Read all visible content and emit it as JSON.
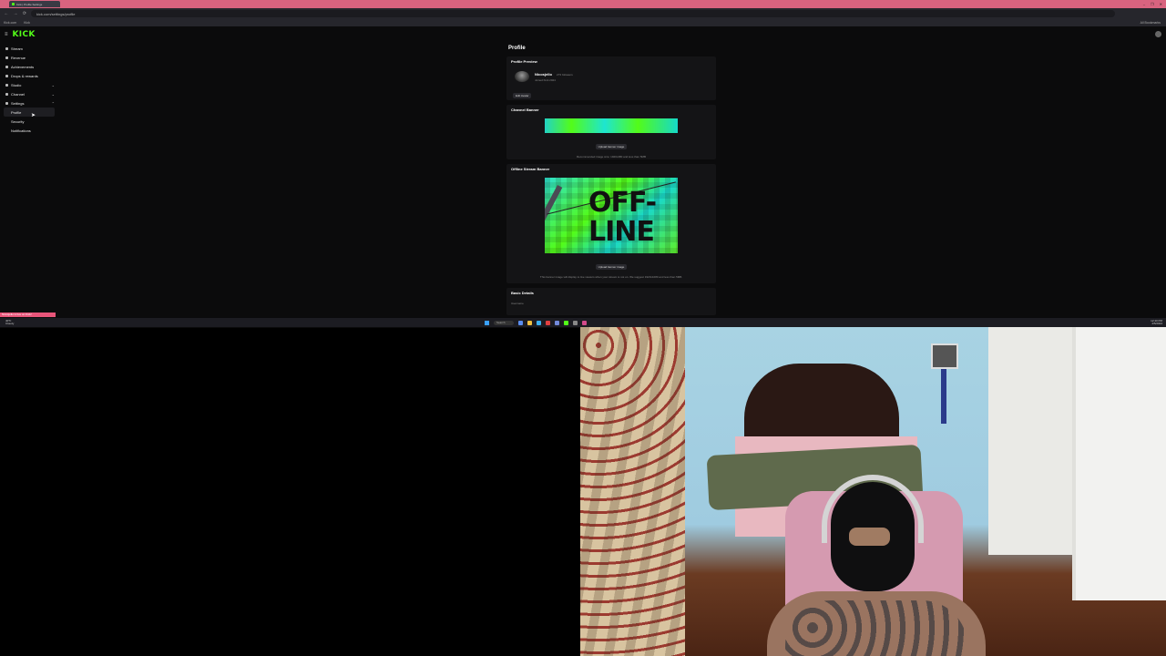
{
  "browser": {
    "tab_title": "Kick | Profile Settings",
    "url": "kick.com/settings/profile",
    "nav": {
      "back": "←",
      "forward": "→",
      "reload": "⟳"
    },
    "bookmarks": [
      "Kick.com",
      "Kick",
      "All Bookmarks"
    ],
    "window_controls": [
      "–",
      "❐",
      "✕"
    ]
  },
  "site": {
    "logo": "KICK",
    "menu_icon": "≡"
  },
  "sidebar": {
    "items": [
      {
        "label": "Stream",
        "icon": "camera-icon"
      },
      {
        "label": "Revenue",
        "icon": "dollar-icon"
      },
      {
        "label": "Achievements",
        "icon": "trophy-icon"
      },
      {
        "label": "Drops & rewards",
        "icon": "gift-icon"
      },
      {
        "label": "Studio",
        "icon": "video-icon",
        "chevron": "⌄"
      },
      {
        "label": "Channel",
        "icon": "tv-icon",
        "chevron": "⌄"
      },
      {
        "label": "Settings",
        "icon": "gear-icon",
        "chevron": "⌃"
      }
    ],
    "sub_items": [
      "Profile",
      "Security",
      "Notifications"
    ]
  },
  "main": {
    "page_title": "Profile",
    "profile_preview": {
      "title": "Profile Preview",
      "name": "Nicosjello",
      "followers": "273 followers",
      "subtitle": "Joined Kick 2024",
      "button": "Edit Avatar"
    },
    "channel_banner": {
      "title": "Channel Banner",
      "button": "Upload banner image",
      "hint": "Recommended image size: 1920x480 and less than 5MB",
      "color_a": "#53fc18",
      "color_b": "#22d3c4"
    },
    "offline_banner": {
      "title": "Offline Stream Banner",
      "image_text_1": "OFF-",
      "image_text_2": "LINE",
      "button": "Upload banner image",
      "hint": "This banner image will display to live viewers when your stream is not on. We suggest 1920x1080 and less than 5MB."
    },
    "basic_details": {
      "title": "Basic Details",
      "field_label": "Username"
    }
  },
  "taskbar": {
    "weather_line1": "40°F",
    "weather_line2": "Cloudy",
    "search_label": "Search",
    "time": "12:40 PM",
    "date": "4/5/2024"
  },
  "notification": {
    "text": "Nicosjello is live on Kick!"
  }
}
